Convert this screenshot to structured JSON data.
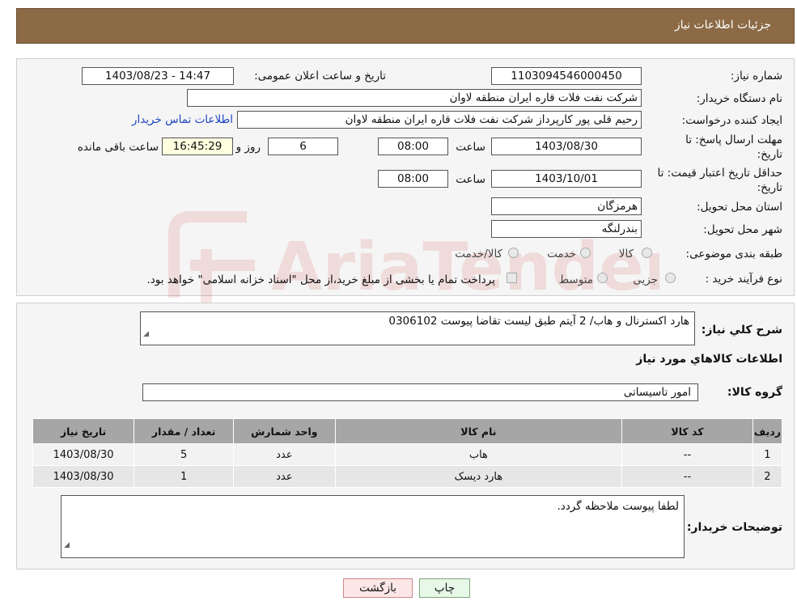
{
  "header": {
    "title": "جزئیات اطلاعات نیاز"
  },
  "watermark": {
    "text": "AriaTender.neT",
    "color": "#c8372d"
  },
  "form": {
    "need_number_label": "شماره نیاز:",
    "need_number": "1103094546000450",
    "announce_label": "تاریخ و ساعت اعلان عمومی:",
    "announce_value": "1403/08/23 - 14:47",
    "buyer_org_label": "نام دستگاه خریدار:",
    "buyer_org": "شرکت نفت فلات قاره ایران منطقه لاوان",
    "creator_label": "ایجاد کننده درخواست:",
    "creator": "رحیم قلی پور کارپرداز شرکت نفت فلات قاره ایران منطقه لاوان",
    "buyer_contact_link": "اطلاعات تماس خریدار",
    "deadline_label_1": "مهلت ارسال پاسخ: تا",
    "deadline_label_2": "تاریخ:",
    "deadline_date": "1403/08/30",
    "time_label": "ساعت",
    "deadline_time": "08:00",
    "days_value": "6",
    "days_label": "روز و",
    "remaining_time": "16:45:29",
    "remaining_label": "ساعت باقی مانده",
    "validity_label_1": "حداقل تاریخ اعتبار قیمت: تا",
    "validity_label_2": "تاریخ:",
    "validity_date": "1403/10/01",
    "validity_time": "08:00",
    "province_label": "استان محل تحویل:",
    "province": "هرمزگان",
    "city_label": "شهر محل تحویل:",
    "city": "بندرلنگه",
    "category_label": "طبقه بندی موضوعی:",
    "category_options": [
      "کالا",
      "خدمت",
      "کالا/خدمت"
    ],
    "process_label": "نوع فرآیند خرید :",
    "process_options": [
      "جزیی",
      "متوسط"
    ],
    "process_note": "پرداخت تمام یا بخشی از مبلغ خرید،از محل \"اسناد خزانه اسلامی\" خواهد بود."
  },
  "details": {
    "description_label": "شرح کلي نياز:",
    "description": "هارد اکسترنال و هاب/ 2 آیتم طبق لیست تقاضا پیوست 0306102",
    "goods_info_title": "اطلاعات کالاهاي مورد نياز",
    "goods_group_label": "گروه کالا:",
    "goods_group": "امور تاسیساتی",
    "table": {
      "headers": [
        "رديف",
        "کد کالا",
        "نام کالا",
        "واحد شمارش",
        "تعداد / مقدار",
        "تاريخ نياز"
      ],
      "rows": [
        [
          "1",
          "--",
          "هاب",
          "عدد",
          "5",
          "1403/08/30"
        ],
        [
          "2",
          "--",
          "هارد دیسک",
          "عدد",
          "1",
          "1403/08/30"
        ]
      ]
    },
    "buyer_notes_label": "توضيحات خريدار:",
    "buyer_notes": "لطفا پیوست ملاحظه گردد."
  },
  "buttons": {
    "print": "چاپ",
    "back": "بازگشت"
  }
}
